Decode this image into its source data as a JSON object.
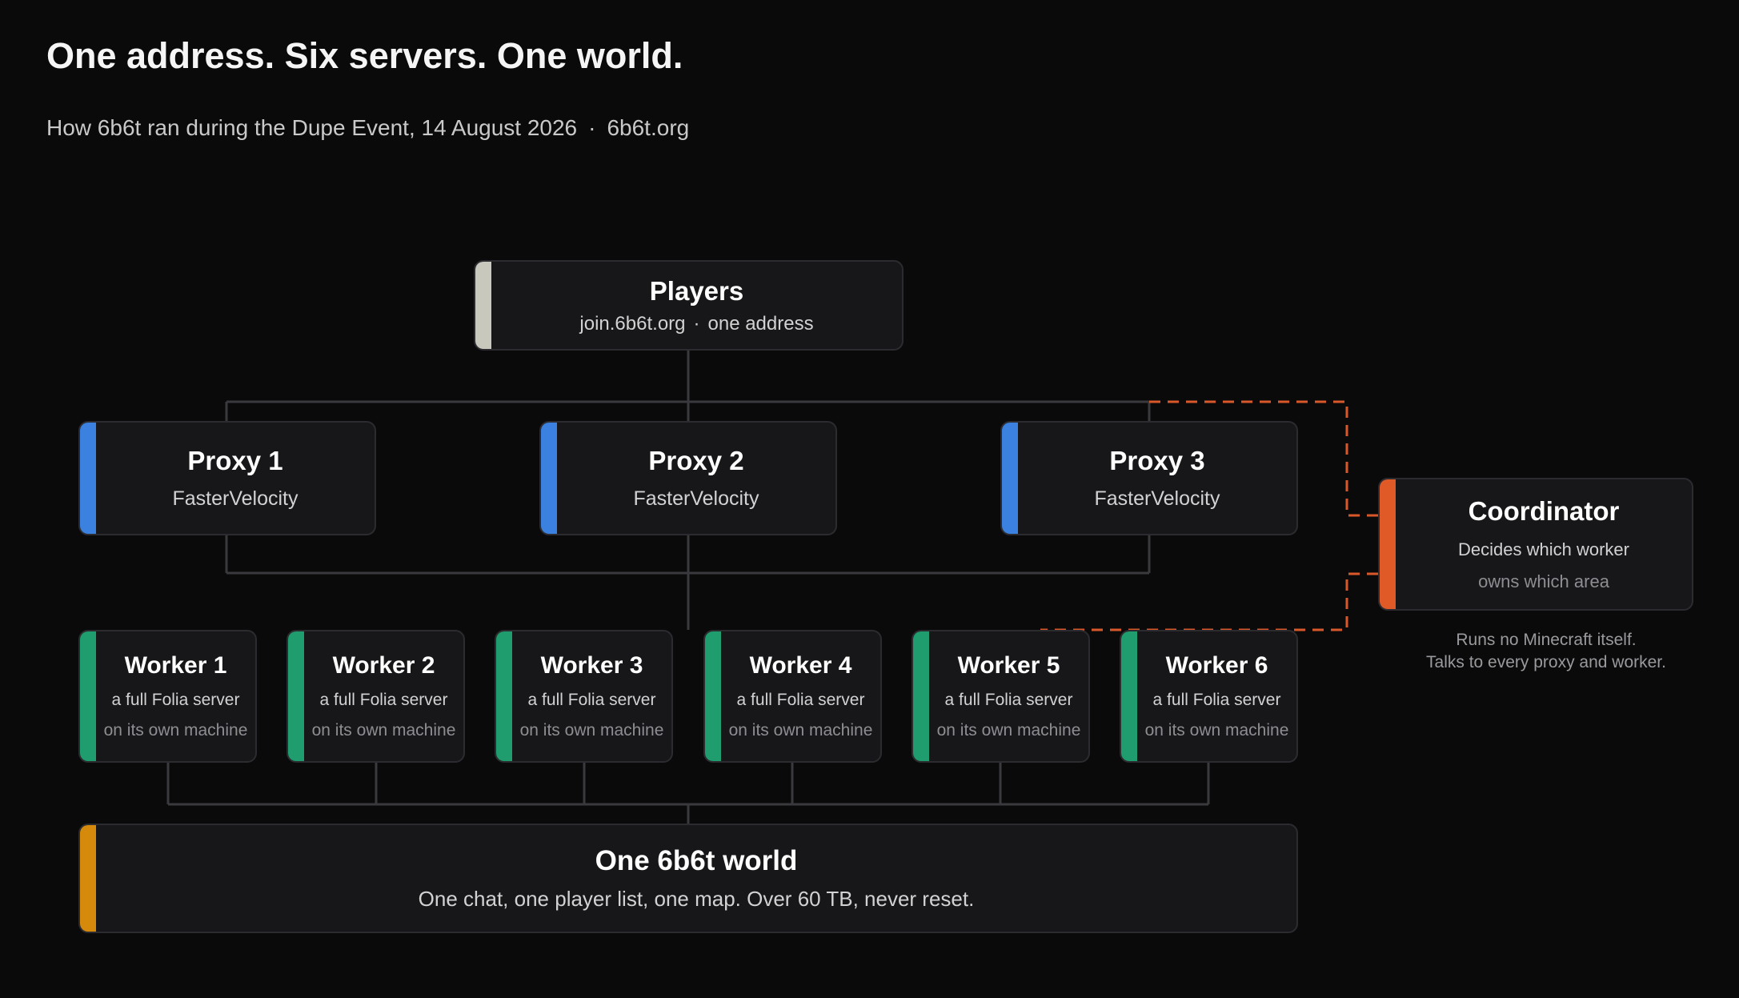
{
  "header": {
    "title": "One address. Six servers. One world.",
    "subtitle_main": "How 6b6t ran during the Dupe Event, 14 August 2026",
    "subtitle_sep": "·",
    "subtitle_site": "6b6t.org"
  },
  "players": {
    "title": "Players",
    "address": "join.6b6t.org",
    "sep": "·",
    "note": "one address"
  },
  "proxies": [
    {
      "title": "Proxy 1",
      "software": "FasterVelocity"
    },
    {
      "title": "Proxy 2",
      "software": "FasterVelocity"
    },
    {
      "title": "Proxy 3",
      "software": "FasterVelocity"
    }
  ],
  "workers": [
    {
      "title": "Worker 1",
      "line1": "a full Folia server",
      "line2": "on its own machine"
    },
    {
      "title": "Worker 2",
      "line1": "a full Folia server",
      "line2": "on its own machine"
    },
    {
      "title": "Worker 3",
      "line1": "a full Folia server",
      "line2": "on its own machine"
    },
    {
      "title": "Worker 4",
      "line1": "a full Folia server",
      "line2": "on its own machine"
    },
    {
      "title": "Worker 5",
      "line1": "a full Folia server",
      "line2": "on its own machine"
    },
    {
      "title": "Worker 6",
      "line1": "a full Folia server",
      "line2": "on its own machine"
    }
  ],
  "coordinator": {
    "title": "Coordinator",
    "line1": "Decides which worker",
    "line2": "owns which area",
    "note_line1": "Runs no Minecraft itself.",
    "note_line2": "Talks to every proxy and worker."
  },
  "world": {
    "title": "One 6b6t world",
    "description": "One chat, one player list, one map. Over 60 TB, never reset."
  },
  "colors": {
    "background": "#0a0a0b",
    "players_accent": "#c8c8bd",
    "proxy_accent": "#3b82e0",
    "worker_accent": "#1f9d6e",
    "coordinator_accent": "#e05a28",
    "world_accent": "#d68a0b",
    "connector": "#3a3a3e",
    "coordinator_link": "#d9582a"
  }
}
